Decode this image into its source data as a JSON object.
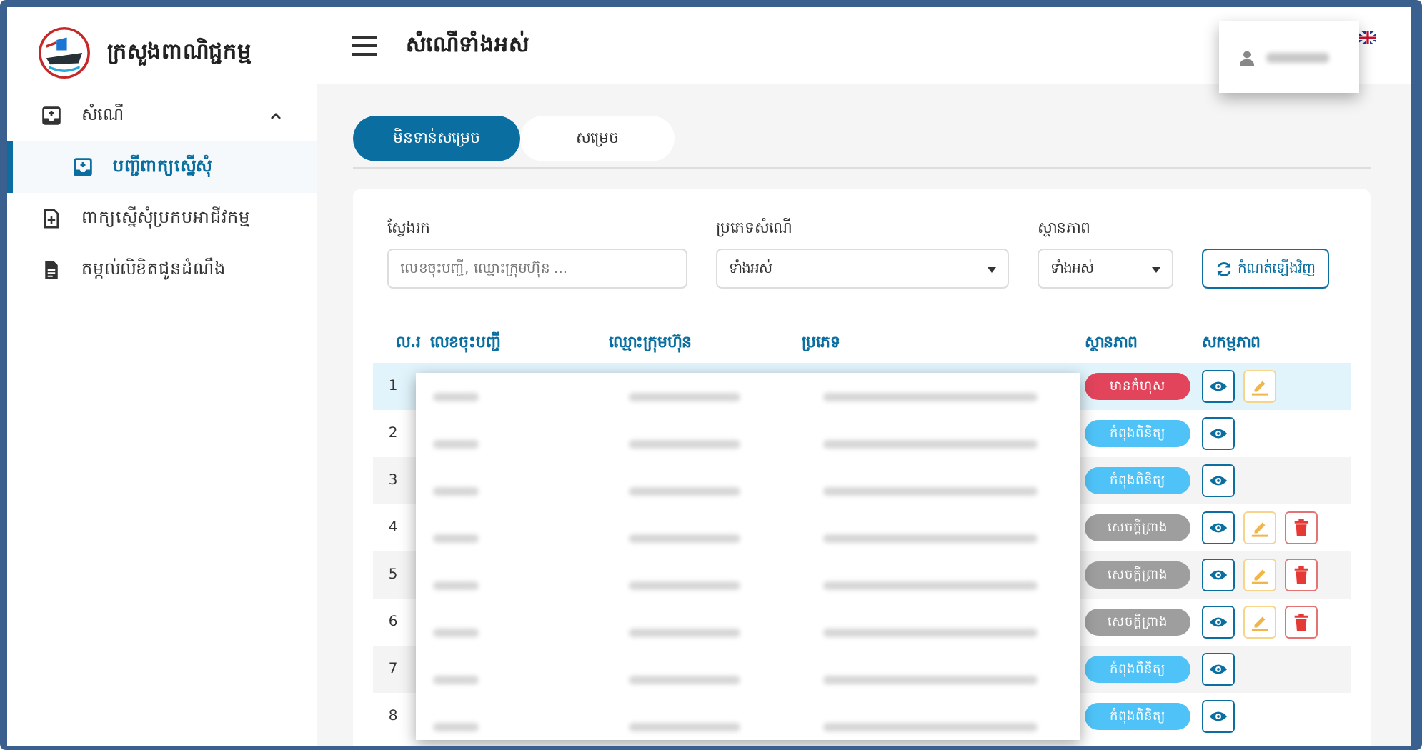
{
  "sidebar": {
    "title": "ក្រសួងពាណិជ្ជកម្ម",
    "items": [
      {
        "label": "សំណើ",
        "expanded": true,
        "selected": false,
        "children": [
          {
            "label": "បញ្ជីពាក្យស្នើសុំ",
            "selected": true
          }
        ]
      },
      {
        "label": "ពាក្យស្នើសុំប្រកបអាជីវកម្ម",
        "selected": false
      },
      {
        "label": "តម្កល់លិខិតជូនដំណឹង",
        "selected": false
      }
    ]
  },
  "header": {
    "title": "សំណើទាំងអស់"
  },
  "tabs": [
    {
      "label": "មិនទាន់សម្រេច",
      "selected": true
    },
    {
      "label": "សម្រេច",
      "selected": false
    }
  ],
  "filters": {
    "search": {
      "label": "ស្វែងរក",
      "placeholder": "លេខចុះបញ្ជី, ឈ្មោះក្រុមហ៊ុន ..."
    },
    "type": {
      "label": "ប្រភេទសំណើ",
      "value": "ទាំងអស់"
    },
    "status": {
      "label": "ស្ថានភាព",
      "value": "ទាំងអស់"
    },
    "reset_button": "កំណត់ឡើងវិញ"
  },
  "table": {
    "columns": [
      "ល.រ",
      "លេខចុះបញ្ជី",
      "ឈ្មោះក្រុមហ៊ុន",
      "ប្រភេទ",
      "ស្ថានភាព",
      "សកម្មភាព"
    ],
    "rows": [
      {
        "no": "1",
        "selected": true,
        "status": {
          "kind": "error",
          "label": "មានកំហុស"
        },
        "view": true,
        "edit": true,
        "delete": false
      },
      {
        "no": "2",
        "selected": false,
        "status": {
          "kind": "review",
          "label": "កំពុងពិនិត្យ"
        },
        "view": true,
        "edit": false,
        "delete": false
      },
      {
        "no": "3",
        "selected": false,
        "status": {
          "kind": "review",
          "label": "កំពុងពិនិត្យ"
        },
        "view": true,
        "edit": false,
        "delete": false
      },
      {
        "no": "4",
        "selected": false,
        "status": {
          "kind": "draft",
          "label": "សេចក្ដីព្រាង"
        },
        "view": true,
        "edit": true,
        "delete": true
      },
      {
        "no": "5",
        "selected": false,
        "status": {
          "kind": "draft",
          "label": "សេចក្ដីព្រាង"
        },
        "view": true,
        "edit": true,
        "delete": true
      },
      {
        "no": "6",
        "selected": false,
        "status": {
          "kind": "draft",
          "label": "សេចក្ដីព្រាង"
        },
        "view": true,
        "edit": true,
        "delete": true
      },
      {
        "no": "7",
        "selected": false,
        "status": {
          "kind": "review",
          "label": "កំពុងពិនិត្យ"
        },
        "view": true,
        "edit": false,
        "delete": false
      },
      {
        "no": "8",
        "selected": false,
        "status": {
          "kind": "review",
          "label": "កំពុងពិនិត្យ"
        },
        "view": true,
        "edit": false,
        "delete": false
      }
    ]
  }
}
